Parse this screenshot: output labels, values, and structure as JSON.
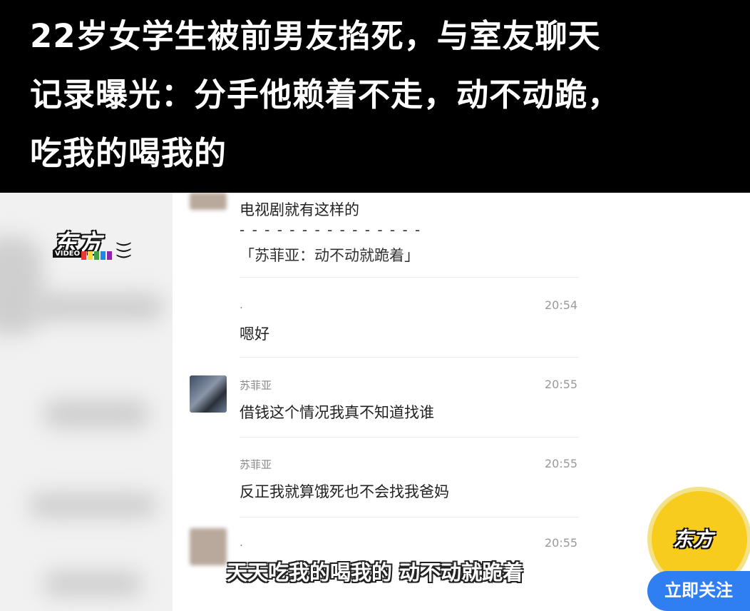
{
  "headline": {
    "line1": "22岁女学生被前男友掐死，与室友聊天",
    "line2": "记录曝光：分手他赖着不走，动不动跪，",
    "line3": "吃我的喝我的"
  },
  "logo": {
    "text": "东方",
    "video": "VIDEO"
  },
  "chat": {
    "quoted_message": {
      "text": "电视剧就有这样的",
      "separator": "- - - - - - - - - - - - - - -",
      "quote": "「苏菲亚：动不动就跪着」"
    },
    "messages": [
      {
        "name": ".",
        "time": "20:54",
        "text": "嗯好"
      },
      {
        "name": "苏菲亚",
        "time": "20:55",
        "text": "借钱这个情况我真不知道找谁"
      },
      {
        "name": "苏菲亚",
        "time": "20:55",
        "text": "反正我就算饿死也不会找我爸妈"
      },
      {
        "name": ".",
        "time": "20:55",
        "text": ""
      }
    ]
  },
  "subtitle": "天天吃我的喝我的 动不动就跪着",
  "follow_button": "立即关注",
  "colors": {
    "accent_blue": "#2f7ff2",
    "badge_yellow": "#f7cc1d",
    "headline_bg": "#000000"
  }
}
